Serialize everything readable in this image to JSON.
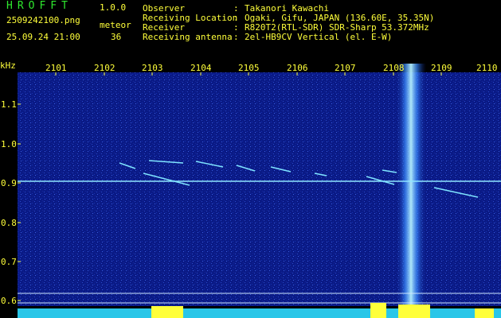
{
  "app": {
    "name": "HROFFT",
    "version": "1.0.0",
    "filename": "2509242100.png",
    "datetime": "25.09.24 21:00",
    "meteor_label": "meteor",
    "meteor_count": "36"
  },
  "info": {
    "labels": [
      "Observer",
      "Receiving Location",
      "Receiver",
      "Receiving antenna"
    ],
    "values": [
      "Takanori Kawachi",
      "Ogaki, Gifu, JAPAN (136.60E, 35.35N)",
      "R820T2(RTL-SDR) SDR-Sharp 53.372MHz",
      "2el-HB9CV Vertical (el. E-W)"
    ]
  },
  "axis": {
    "unit": "kHz",
    "x_ticks": [
      "2101",
      "2102",
      "2103",
      "2104",
      "2105",
      "2106",
      "2107",
      "2108",
      "2109",
      "2110"
    ],
    "y_ticks": [
      "1.1",
      "1.0",
      "0.9",
      "0.8",
      "0.7",
      "0.6"
    ]
  },
  "colors": {
    "background": "#000000",
    "spectrum": "#0b1d8a",
    "signal": "#9ff0ff",
    "text_green": "#2ee82e",
    "text_yellow": "#ffff3a"
  }
}
